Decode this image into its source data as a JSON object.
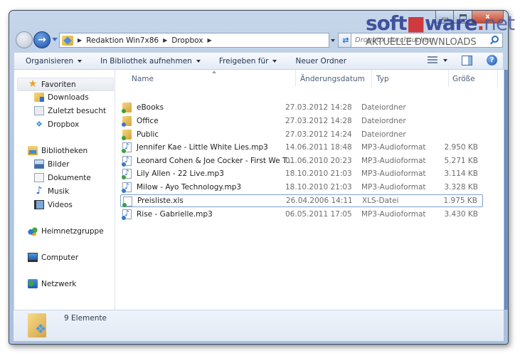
{
  "window": {
    "controls": {
      "minimize": "minimize",
      "maximize": "maximize",
      "close": "x"
    }
  },
  "nav": {
    "breadcrumbs": [
      "Redaktion Win7x86",
      "Dropbox"
    ],
    "search_placeholder": "Dropbox durchsuchen"
  },
  "toolbar": {
    "organize": "Organisieren",
    "include_library": "In Bibliothek aufnehmen",
    "share_with": "Freigeben für",
    "new_folder": "Neuer Ordner",
    "help": "?"
  },
  "sidebar": {
    "favorites": {
      "label": "Favoriten",
      "items": [
        "Downloads",
        "Zuletzt besucht",
        "Dropbox"
      ]
    },
    "libraries": {
      "label": "Bibliotheken",
      "items": [
        "Bilder",
        "Dokumente",
        "Musik",
        "Videos"
      ]
    },
    "homegroup": "Heimnetzgruppe",
    "computer": "Computer",
    "network": "Netzwerk"
  },
  "filelist": {
    "columns": {
      "name": "Name",
      "date": "Änderungsdatum",
      "type": "Typ",
      "size": "Größe"
    },
    "rows": [
      {
        "name": "eBooks",
        "date": "27.03.2012 14:28",
        "type": "Dateiordner",
        "size": "",
        "icon": "folder-synced"
      },
      {
        "name": "Office",
        "date": "27.03.2012 14:28",
        "type": "Dateiordner",
        "size": "",
        "icon": "folder-syncing"
      },
      {
        "name": "Public",
        "date": "27.03.2012 14:24",
        "type": "Dateiordner",
        "size": "",
        "icon": "folder-shared"
      },
      {
        "name": "Jennifer Kae - Little White Lies.mp3",
        "date": "14.06.2011 18:48",
        "type": "MP3-Audioformat",
        "size": "2.950 KB",
        "icon": "audio-synced"
      },
      {
        "name": "Leonard Cohen & Joe Cocker - First We T...",
        "date": "01.06.2010 20:23",
        "type": "MP3-Audioformat",
        "size": "5.271 KB",
        "icon": "audio-syncing"
      },
      {
        "name": "Lily Allen - 22 Live.mp3",
        "date": "18.10.2010 21:03",
        "type": "MP3-Audioformat",
        "size": "3.114 KB",
        "icon": "audio-synced"
      },
      {
        "name": "Milow - Ayo Technology.mp3",
        "date": "18.10.2010 21:03",
        "type": "MP3-Audioformat",
        "size": "3.328 KB",
        "icon": "audio-syncing"
      },
      {
        "name": "Preisliste.xls",
        "date": "26.04.2006 14:11",
        "type": "XLS-Datei",
        "size": "1.975 KB",
        "icon": "xls-synced",
        "selected": true
      },
      {
        "name": "Rise - Gabrielle.mp3",
        "date": "06.05.2011 17:05",
        "type": "MP3-Audioformat",
        "size": "3.430 KB",
        "icon": "audio-syncing"
      }
    ]
  },
  "status": {
    "count": "9 Elemente"
  },
  "watermark": {
    "logo_main": "soft",
    "logo_mid": "ware",
    "logo_tld": "net",
    "subtitle": "AKTUELLE DOWNLOADS"
  },
  "colors": {
    "accent": "#1b4fa6",
    "selection_border": "#7da2ce",
    "sync_green": "#3ca043",
    "sync_blue": "#3a78c8"
  }
}
